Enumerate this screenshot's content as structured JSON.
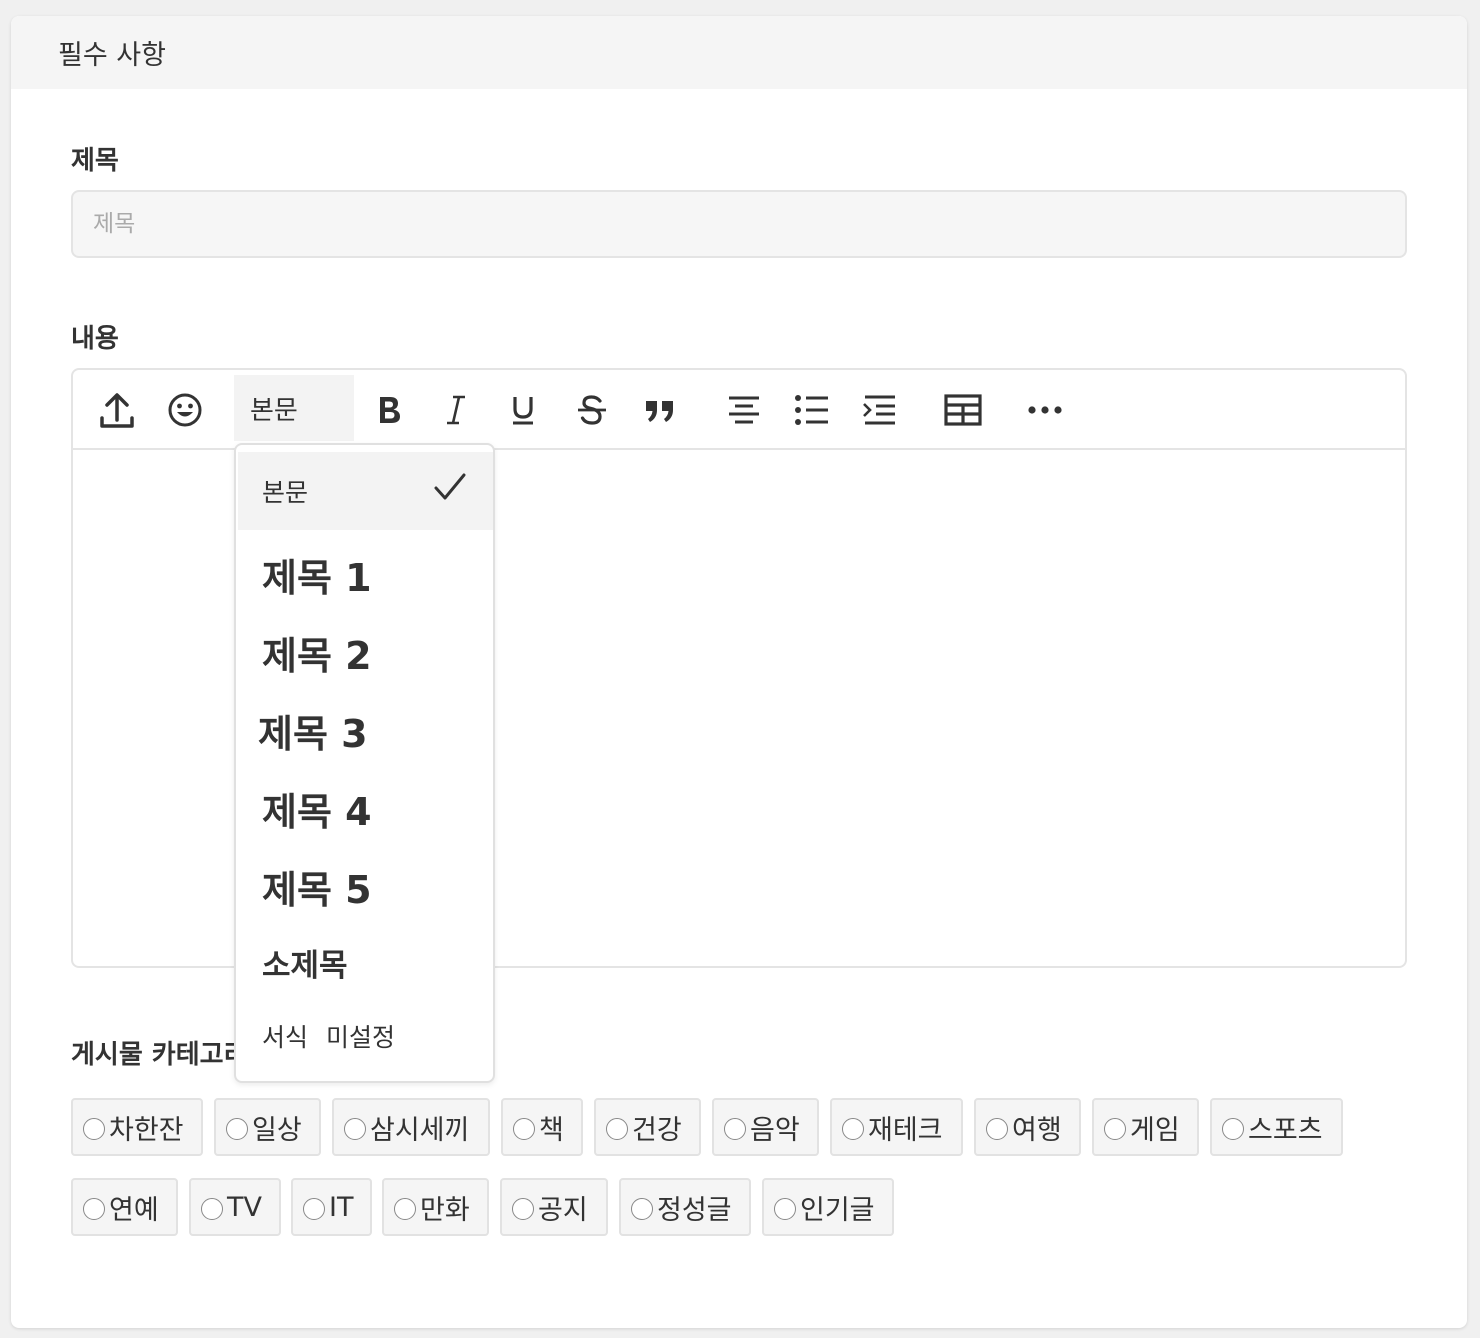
{
  "header": {
    "title": "필수 사항"
  },
  "title_field": {
    "label": "제목",
    "placeholder": "제목",
    "value": ""
  },
  "content_field": {
    "label": "내용",
    "toolbar": {
      "format_select_value": "본문",
      "icons": [
        "upload-icon",
        "emoji-icon",
        "bold-icon",
        "italic-icon",
        "underline-icon",
        "strikethrough-icon",
        "quote-icon",
        "align-center-icon",
        "bullet-list-icon",
        "indent-icon",
        "table-icon",
        "more-icon"
      ]
    },
    "format_menu": {
      "items": [
        "본문",
        "제목 1",
        "제목 2",
        "제목 3",
        "제목 4",
        "제목 5",
        "소제목",
        "서식 미설정"
      ],
      "selected": "본문"
    }
  },
  "category": {
    "label": "게시물 카테고리",
    "options_row1": [
      "차한잔",
      "일상",
      "삼시세끼",
      "책",
      "건강",
      "음악",
      "재테크",
      "여행",
      "게임",
      "스포츠"
    ],
    "options_row2": [
      "연예",
      "TV",
      "IT",
      "만화",
      "공지",
      "정성글",
      "인기글"
    ]
  },
  "colors": {
    "background": "#f0f0f0",
    "card": "#ffffff",
    "header_bg": "#f5f5f5",
    "text": "#333333",
    "border": "#e4e4e4"
  }
}
